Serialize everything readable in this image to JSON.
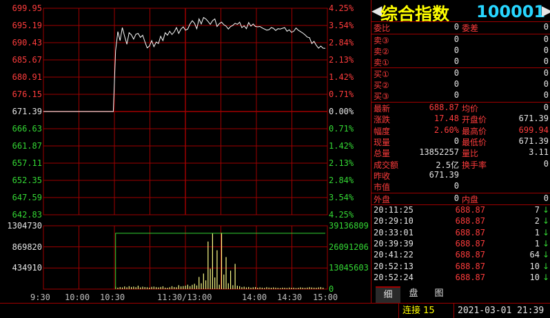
{
  "colors": {
    "up": "#ff3c3c",
    "down": "#34d834",
    "neutral": "#e6e6e6",
    "grid": "#a00000",
    "price_line": "#ffffff",
    "volume": "#ffff88",
    "volume_ref": "#34d834"
  },
  "price_axis": {
    "left": [
      "699.95",
      "695.19",
      "690.43",
      "685.67",
      "680.91",
      "676.15",
      "671.39",
      "666.63",
      "661.87",
      "657.11",
      "652.35",
      "647.59",
      "642.83"
    ],
    "right": [
      "4.25%",
      "3.54%",
      "2.84%",
      "2.13%",
      "1.42%",
      "0.71%",
      "0.00%",
      "0.71%",
      "1.42%",
      "2.13%",
      "2.84%",
      "3.54%",
      "4.25%"
    ]
  },
  "volume_axis": {
    "left": [
      "1304730",
      "869820",
      "434910"
    ],
    "right": [
      "39136809",
      "26091206",
      "13045603",
      "0"
    ]
  },
  "time_axis": [
    "9:30",
    "10:00",
    "10:30",
    "11:30/13:00",
    "14:00",
    "14:30",
    "15:00"
  ],
  "chart_data": {
    "type": "line",
    "title": "",
    "ylim": [
      642.83,
      699.95
    ],
    "base_price": 671.39,
    "open_flat_until": 0.5,
    "series": [
      {
        "values": [
          671.39,
          671.39,
          671.39,
          671.39,
          671.39,
          671.39,
          671.39,
          671.39,
          671.39,
          671.39,
          671.39,
          671.39,
          671.39,
          671.39,
          671.39,
          671.39,
          671.39,
          671.39,
          671.39,
          671.39,
          671.39,
          671.39,
          671.39,
          671.39,
          671.39,
          671.39,
          671.39,
          671.39,
          671.39,
          671.39,
          671.39,
          671.39,
          688.2,
          693.5,
          691.0,
          694.6,
          692.2,
          690.0,
          693.2,
          692.6,
          691.4,
          692.8,
          693.0,
          691.9,
          692.5,
          690.7,
          689.0,
          689.5,
          691.0,
          689.3,
          690.6,
          690.2,
          692.2,
          691.0,
          693.2,
          692.5,
          693.6,
          692.7,
          693.4,
          694.6,
          693.0,
          694.2,
          694.8,
          693.9,
          694.2,
          695.6,
          696.5,
          695.8,
          694.3,
          697.0,
          695.6,
          697.4,
          697.0,
          696.3,
          695.5,
          696.5,
          697.0,
          694.9,
          695.7,
          696.1,
          695.4,
          695.0,
          694.2,
          694.9,
          695.2,
          695.8,
          695.5,
          696.1,
          694.6,
          695.1,
          694.3,
          696.0,
          695.0,
          695.6,
          694.9,
          694.8,
          694.9,
          694.5,
          694.2,
          693.9,
          694.0,
          694.6,
          694.4,
          693.8,
          694.3,
          694.2,
          694.4,
          694.6,
          693.6,
          694.0,
          693.3,
          693.6,
          694.5,
          693.9,
          693.5,
          693.1,
          692.6,
          692.0,
          691.8,
          690.2,
          690.8,
          689.7,
          688.9,
          689.5,
          688.9,
          688.87
        ]
      }
    ],
    "volume_values": [
      0,
      0,
      0,
      0,
      0,
      0,
      0,
      0,
      0,
      0,
      0,
      0,
      0,
      0,
      0,
      0,
      0,
      0,
      0,
      0,
      0,
      0,
      0,
      0,
      0,
      0,
      0,
      0,
      0,
      0,
      0,
      0,
      48000,
      30000,
      42000,
      35000,
      55000,
      38000,
      60000,
      44000,
      52000,
      40000,
      70000,
      36000,
      50000,
      42000,
      38000,
      30000,
      46000,
      52000,
      40000,
      35000,
      44000,
      58000,
      30000,
      26000,
      39000,
      60000,
      42000,
      38000,
      80000,
      55000,
      62000,
      70000,
      90000,
      60000,
      88000,
      110000,
      75000,
      250000,
      120000,
      320000,
      180000,
      980000,
      420000,
      1150000,
      240000,
      800000,
      90000,
      1160000,
      300000,
      660000,
      120000,
      380000,
      80000,
      520000,
      70000,
      60000,
      40000,
      50000,
      35000,
      44000,
      30000,
      38000,
      42000,
      28000,
      36000,
      30000,
      25000,
      40000,
      32000,
      28000,
      35000,
      30000,
      26000,
      22000,
      30000,
      28000,
      24000,
      32000,
      26000,
      30000,
      22000,
      28000,
      36000,
      30000,
      26000,
      32000,
      40000,
      34000,
      30000,
      28000,
      36000,
      42000,
      30000
    ],
    "cumulative_flat_value": 1150000
  },
  "quote": {
    "name": "综合指数",
    "code": "100001",
    "weibi_label": "委比",
    "weibi": "0",
    "weicha_label": "委差",
    "weicha": "0",
    "sells": [
      {
        "label": "卖③",
        "price": "0",
        "vol": "0"
      },
      {
        "label": "卖②",
        "price": "0",
        "vol": "0"
      },
      {
        "label": "卖①",
        "price": "0",
        "vol": "0"
      }
    ],
    "buys": [
      {
        "label": "买①",
        "price": "0",
        "vol": "0"
      },
      {
        "label": "买②",
        "price": "0",
        "vol": "0"
      },
      {
        "label": "买③",
        "price": "0",
        "vol": "0"
      }
    ],
    "stats": [
      {
        "l1": "最新",
        "v1": "688.87",
        "c1": "red",
        "l2": "均价",
        "v2": "0",
        "c2": "white"
      },
      {
        "l1": "涨跌",
        "v1": "17.48",
        "c1": "red",
        "l2": "开盘价",
        "v2": "671.39",
        "c2": "white"
      },
      {
        "l1": "幅度",
        "v1": "2.60%",
        "c1": "red",
        "l2": "最高价",
        "v2": "699.94",
        "c2": "red"
      },
      {
        "l1": "现量",
        "v1": "0",
        "c1": "white",
        "l2": "最低价",
        "v2": "671.39",
        "c2": "white"
      },
      {
        "l1": "总量",
        "v1": "13852257",
        "c1": "white",
        "l2": "量比",
        "v2": "3.11",
        "c2": "white"
      },
      {
        "l1": "成交额",
        "v1": "2.5亿",
        "c1": "white",
        "l2": "换手率",
        "v2": "0",
        "c2": "white"
      },
      {
        "l1": "昨收",
        "v1": "671.39",
        "c1": "white",
        "l2": "",
        "v2": "",
        "c2": "white"
      },
      {
        "l1": "市值",
        "v1": "0",
        "c1": "white",
        "l2": "",
        "v2": "",
        "c2": "white"
      }
    ],
    "waipan_label": "外盘",
    "waipan": "0",
    "neipan_label": "内盘",
    "neipan": "0"
  },
  "ticks": [
    {
      "time": "20:11:25",
      "price": "688.87",
      "vol": "7",
      "dir": "↓"
    },
    {
      "time": "20:29:10",
      "price": "688.87",
      "vol": "2",
      "dir": "↓"
    },
    {
      "time": "20:33:01",
      "price": "688.87",
      "vol": "1",
      "dir": "↓"
    },
    {
      "time": "20:39:39",
      "price": "688.87",
      "vol": "1",
      "dir": "↓"
    },
    {
      "time": "20:41:22",
      "price": "688.87",
      "vol": "64",
      "dir": "↓"
    },
    {
      "time": "20:52:13",
      "price": "688.87",
      "vol": "10",
      "dir": "↓"
    },
    {
      "time": "20:52:24",
      "price": "688.87",
      "vol": "10",
      "dir": "↓"
    }
  ],
  "tabs": [
    "细",
    "盘",
    "图"
  ],
  "status": {
    "connect": "连接 15",
    "datetime": "2021-03-01 21:39"
  }
}
